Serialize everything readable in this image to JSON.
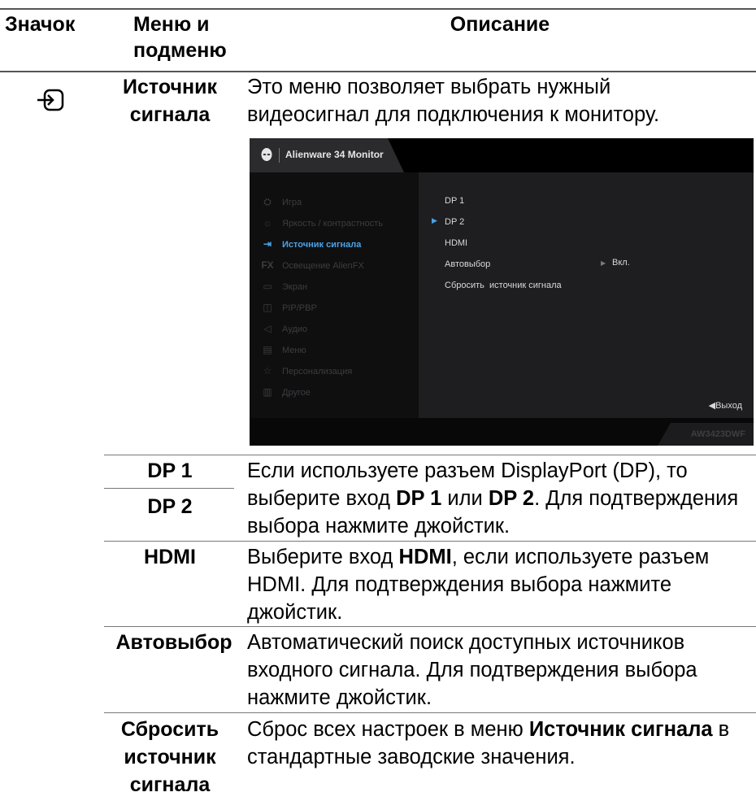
{
  "header": {
    "icon": "Значок",
    "menu": "Меню и подменю",
    "description": "Описание"
  },
  "row_source": {
    "icon": "input-source-icon",
    "label": "Источник сигнала",
    "description": "Это меню позволяет выбрать нужный видеосигнал для подключения к монитору."
  },
  "osd": {
    "title": "Alienware 34 Monitor",
    "model": "AW3423DWF",
    "menu_items": [
      {
        "icon": "gamepad-icon",
        "label": "Игра"
      },
      {
        "icon": "brightness-icon",
        "label": "Яркость / контрастность"
      },
      {
        "icon": "input-source-icon",
        "label": "Источник сигнала"
      },
      {
        "icon": "fx-icon",
        "label": "Освещение AlienFX"
      },
      {
        "icon": "display-icon",
        "label": "Экран"
      },
      {
        "icon": "pip-pbp-icon",
        "label": "PIP/PBP"
      },
      {
        "icon": "speaker-icon",
        "label": "Аудио"
      },
      {
        "icon": "menu-icon",
        "label": "Меню"
      },
      {
        "icon": "star-icon",
        "label": "Персонализация"
      },
      {
        "icon": "other-icon",
        "label": "Другое"
      }
    ],
    "sub_items": [
      "DP 1",
      "DP 2",
      "HDMI",
      "Автовыбор",
      "Сбросить  источник сигнала"
    ],
    "auto_value": "Вкл.",
    "exit": "◀Выход"
  },
  "rows": {
    "dp1": "DP 1",
    "dp2": "DP 2",
    "dp_desc": {
      "a": "Если используете разъем DisplayPort (DP), то",
      "b1": "выберите вход ",
      "b2": "DP 1",
      "b3": " или ",
      "b4": "DP 2",
      "b5": ". Для подтверждения",
      "c": "выбора нажмите джойстик."
    },
    "hdmi": "HDMI",
    "hdmi_desc": {
      "a1": "Выберите вход ",
      "a2": "HDMI",
      "a3": ", если используете разъем",
      "b": "HDMI. Для подтверждения выбора нажмите",
      "c": "джойстик."
    },
    "auto": "Автовыбор",
    "auto_desc": {
      "a": "Автоматический поиск доступных источников",
      "b": "входного сигнала. Для подтверждения выбора",
      "c": "нажмите джойстик."
    },
    "reset": {
      "l1": "Сбросить",
      "l2": "источник",
      "l3": "сигнала"
    },
    "reset_desc": {
      "a1": "Сброс всех настроек в меню ",
      "a2": "Источник сигнала",
      "a3": " в",
      "b": "стандартные заводские значения."
    }
  }
}
